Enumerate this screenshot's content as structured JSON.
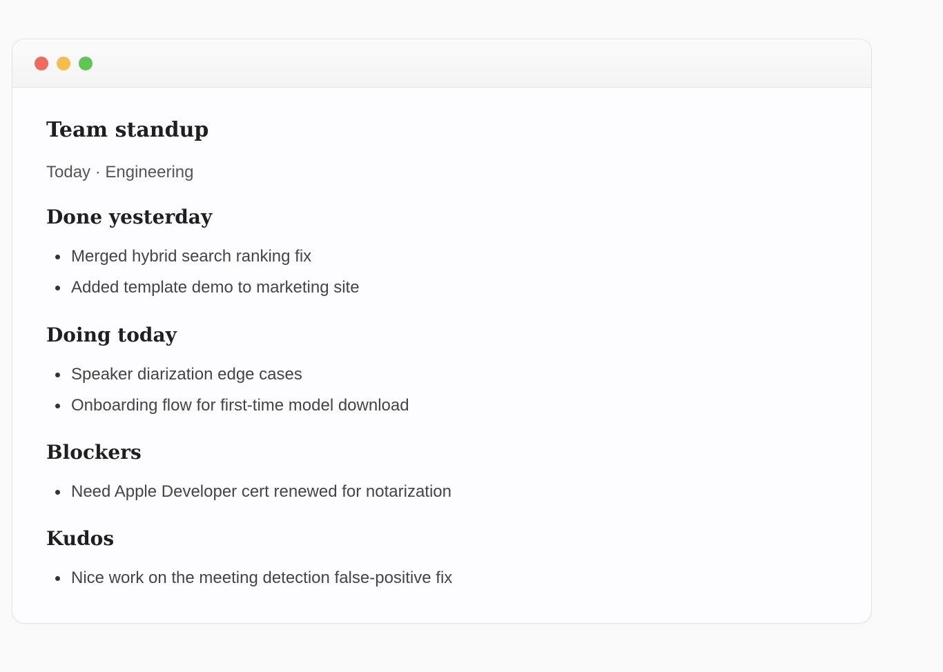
{
  "colors": {
    "background": "#f9f9f9",
    "window_background": "#fdfdff",
    "traffic_close": "#ef6b5f",
    "traffic_minimize": "#f5bd4f",
    "traffic_zoom": "#61c454"
  },
  "document": {
    "title": "Team standup",
    "meta": "Today · Engineering",
    "sections": [
      {
        "heading": "Done yesterday",
        "items": [
          "Merged hybrid search ranking fix",
          "Added template demo to marketing site"
        ]
      },
      {
        "heading": "Doing today",
        "items": [
          "Speaker diarization edge cases",
          "Onboarding flow for first-time model download"
        ]
      },
      {
        "heading": "Blockers",
        "items": [
          "Need Apple Developer cert renewed for notarization"
        ]
      },
      {
        "heading": "Kudos",
        "items": [
          "Nice work on the meeting detection false-positive fix"
        ]
      }
    ]
  }
}
